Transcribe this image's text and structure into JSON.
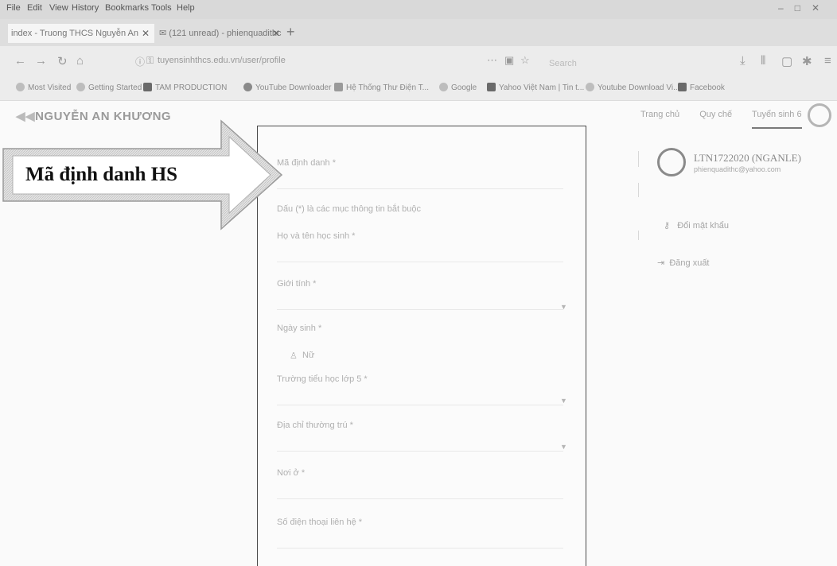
{
  "menubar": {
    "items": [
      "File",
      "Edit",
      "View",
      "History",
      "Bookmarks",
      "Tools",
      "Help"
    ]
  },
  "tabs": [
    {
      "title": "index - Truong THCS Nguyễn An"
    },
    {
      "title": "(121 unread) - phienquadithc"
    }
  ],
  "nav": {
    "url": "tuyensinhthcs.edu.vn/user/profile",
    "search_placeholder": "Search"
  },
  "bookmarks": [
    {
      "label": "Most Visited",
      "color": "#9a9a9a"
    },
    {
      "label": "Getting Started",
      "color": "#9a9a9a"
    },
    {
      "label": "TAM PRODUCTION",
      "color": "#6a6a6a"
    },
    {
      "label": "YouTube Downloader",
      "color": "#7a7a7a"
    },
    {
      "label": "Hệ Thống Thư Điện T...",
      "color": "#8a8a8a"
    },
    {
      "label": "Google",
      "color": "#9a9a9a"
    },
    {
      "label": "Yahoo Việt Nam | Tin t...",
      "color": "#6a6a6a"
    },
    {
      "label": "Youtube Download Vi...",
      "color": "#8a8a8a"
    },
    {
      "label": "Facebook",
      "color": "#6a6a6a"
    }
  ],
  "site": {
    "logo_text": "NGUYỄN AN KHƯƠNG",
    "nav": [
      "Trang chủ",
      "Quy chế",
      "Tuyển sinh 6"
    ]
  },
  "form": {
    "fields": [
      {
        "label": "Mã định danh *"
      },
      {
        "label": "Dấu (*) là các mục thông tin bắt buộc"
      },
      {
        "label": "Họ và tên học sinh *"
      },
      {
        "label": "Giới tính *"
      },
      {
        "label": "Ngày sinh *"
      },
      {
        "label": "Nữ"
      },
      {
        "label": "Trường tiểu học lớp 5 *"
      },
      {
        "label": "Địa chỉ thường trú *"
      },
      {
        "label": "Nơi ở *"
      },
      {
        "label": "Số điện thoại liên hệ *"
      }
    ]
  },
  "account": {
    "username": "LTN1722020 (NGANLE)",
    "email": "phienquadithc@yahoo.com",
    "menu": [
      "Đổi mật khẩu",
      "Đăng xuất"
    ]
  },
  "callout": {
    "text": "Mã định danh HS"
  }
}
